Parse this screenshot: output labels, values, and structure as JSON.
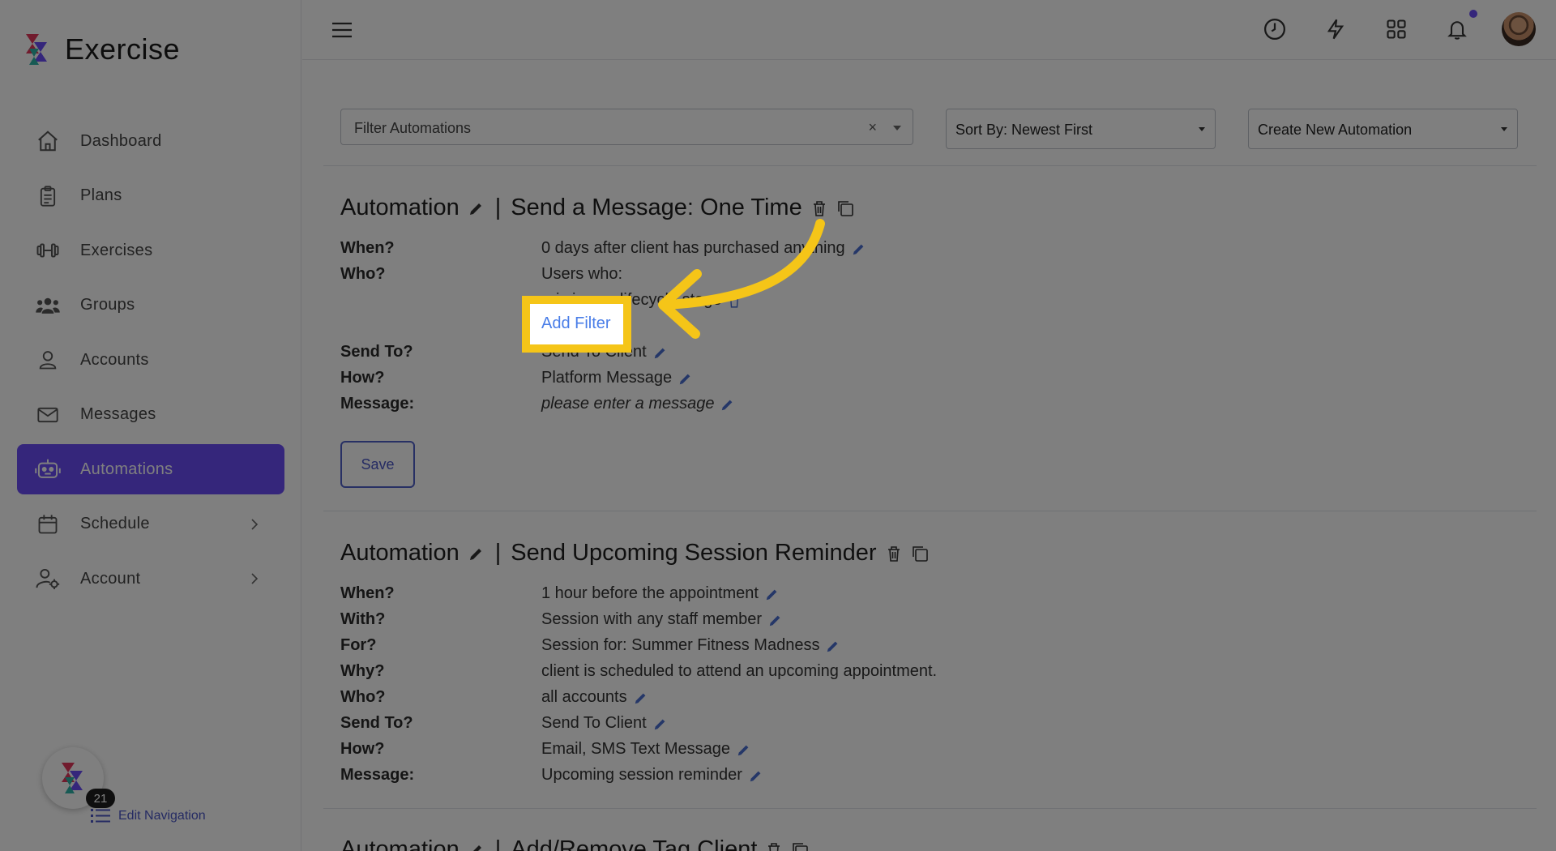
{
  "app": {
    "name": "Exercise"
  },
  "sidebar": {
    "items": [
      {
        "label": "Dashboard",
        "icon": "home-icon"
      },
      {
        "label": "Plans",
        "icon": "clipboard-icon"
      },
      {
        "label": "Exercises",
        "icon": "dumbbell-icon"
      },
      {
        "label": "Groups",
        "icon": "users-icon"
      },
      {
        "label": "Accounts",
        "icon": "user-icon"
      },
      {
        "label": "Messages",
        "icon": "envelope-icon"
      },
      {
        "label": "Automations",
        "icon": "robot-icon",
        "active": true
      },
      {
        "label": "Schedule",
        "icon": "calendar-icon",
        "has_children": true
      },
      {
        "label": "Account",
        "icon": "user-gear-icon",
        "has_children": true
      }
    ],
    "badge_count": "21",
    "edit_navigation": "Edit Navigation"
  },
  "topbar": {
    "icons": [
      "menu-icon",
      "clock-icon",
      "lightning-icon",
      "apps-grid-icon",
      "bell-icon",
      "avatar"
    ]
  },
  "filters": {
    "filter_placeholder": "Filter Automations",
    "clear_symbol": "×",
    "sort_value": "Sort By: Newest First",
    "create_value": "Create New Automation"
  },
  "automations": [
    {
      "prefix": "Automation",
      "sep": "|",
      "name": "Send a Message: One Time",
      "rows": [
        {
          "key": "When?",
          "value": "0 days after client has purchased anything"
        },
        {
          "key": "Who?",
          "value": "Users who:"
        },
        {
          "key": "",
          "value": "is in any lifecycle stage"
        },
        {
          "key": "Send To?",
          "value": "Send To Client"
        },
        {
          "key": "How?",
          "value": "Platform Message"
        },
        {
          "key": "Message:",
          "value": "please enter a message"
        }
      ],
      "add_filter": "Add Filter",
      "save_label": "Save"
    },
    {
      "prefix": "Automation",
      "sep": "|",
      "name": "Send Upcoming Session Reminder",
      "rows": [
        {
          "key": "When?",
          "value": "1 hour before the appointment"
        },
        {
          "key": "With?",
          "value": "Session with any staff member"
        },
        {
          "key": "For?",
          "value": "Session for: Summer Fitness Madness"
        },
        {
          "key": "Why?",
          "value": "client is scheduled to attend an upcoming appointment."
        },
        {
          "key": "Who?",
          "value": "all accounts"
        },
        {
          "key": "Send To?",
          "value": "Send To Client"
        },
        {
          "key": "How?",
          "value": "Email, SMS Text Message"
        },
        {
          "key": "Message:",
          "value": "Upcoming session reminder"
        }
      ]
    },
    {
      "prefix": "Automation",
      "sep": "|",
      "name": "Add/Remove Tag Client"
    }
  ],
  "colors": {
    "accent": "#6a4cf6",
    "highlight": "#f5c518",
    "link": "#4a7ee8"
  }
}
